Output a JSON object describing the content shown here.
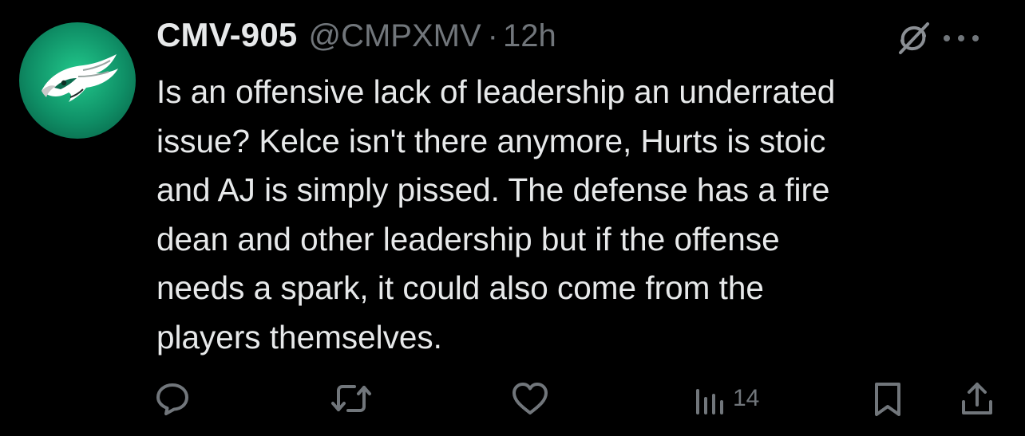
{
  "tweet": {
    "display_name": "CMV-905",
    "handle": "@CMPXMV",
    "separator": "·",
    "time": "12h",
    "text_lines": [
      "Is an offensive lack of leadership an underrated",
      "issue? Kelce isn't there anymore, Hurts is stoic",
      "and AJ is simply pissed. The defense has a fire",
      "dean and other leadership but if the offense",
      "needs a spark, it could also come from the",
      "players themselves."
    ],
    "views": "14"
  },
  "icons": {
    "avatar": "eagles-logo-avatar",
    "grok": "grok-icon",
    "more": "more-dots-icon",
    "reply": "reply-bubble-icon",
    "retweet": "retweet-icon",
    "like": "heart-icon",
    "views": "views-bar-chart-icon",
    "bookmark": "bookmark-icon",
    "share": "share-upload-icon"
  },
  "colors": {
    "background": "#000000",
    "primary_text": "#e7e9ea",
    "secondary_text": "#71767b",
    "avatar_green": "#1bb884"
  }
}
